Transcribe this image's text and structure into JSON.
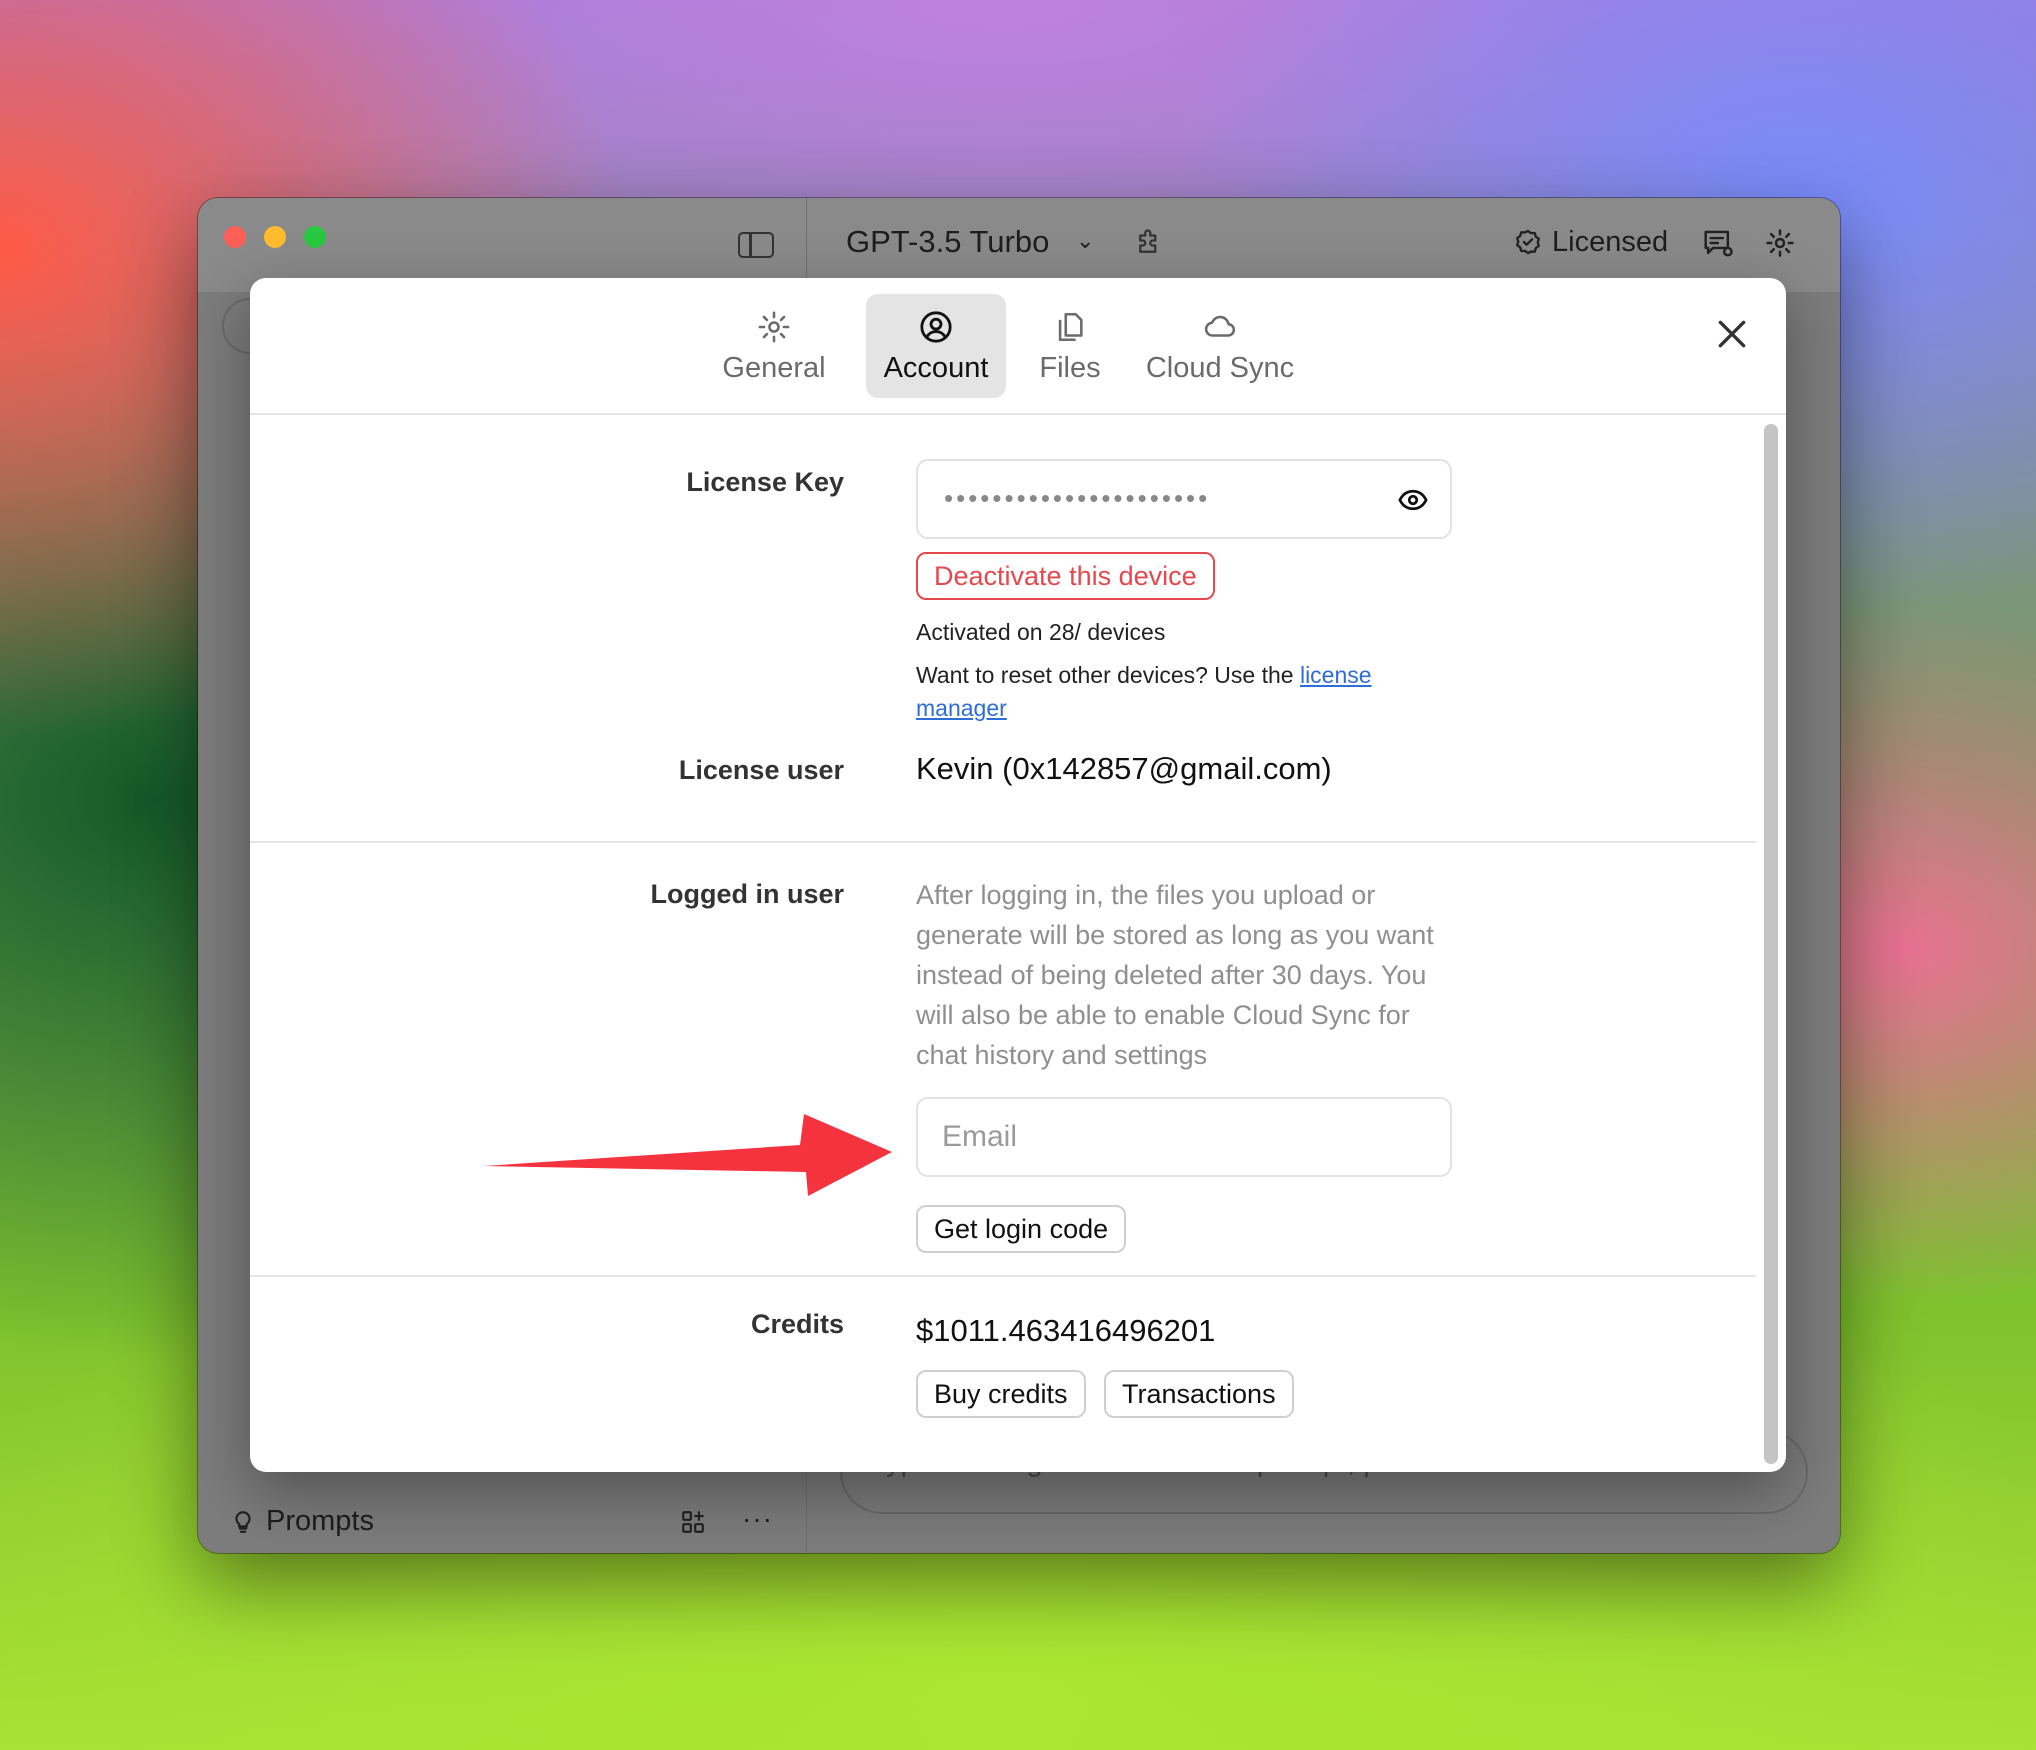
{
  "window": {
    "model_title": "GPT-3.5 Turbo",
    "licensed_label": "Licensed",
    "prompts_label": "Prompts",
    "message_placeholder": "Type message or / to select a prompt, press ↵ to send"
  },
  "settings": {
    "tabs": [
      {
        "label": "General",
        "icon": "gear-icon",
        "active": false
      },
      {
        "label": "Account",
        "icon": "user-circle-icon",
        "active": true
      },
      {
        "label": "Files",
        "icon": "files-icon",
        "active": false
      },
      {
        "label": "Cloud Sync",
        "icon": "cloud-icon",
        "active": false
      }
    ],
    "license": {
      "label": "License Key",
      "masked_value": "••••••••••••••••••••••",
      "deactivate_label": "Deactivate this device",
      "activated_text": "Activated on 28/ devices",
      "reset_text_prefix": "Want to reset other devices? Use the ",
      "reset_link": "license manager"
    },
    "license_user": {
      "label": "License user",
      "value": "Kevin (0x142857@gmail.com)"
    },
    "logged_in_user": {
      "label": "Logged in user",
      "description": "After logging in, the files you upload or generate will be stored as long as you want instead of being deleted after 30 days. You will also be able to enable Cloud Sync for chat history and settings",
      "email_placeholder": "Email",
      "get_code_label": "Get login code"
    },
    "credits": {
      "label": "Credits",
      "value": "$1011.463416496201",
      "buy_label": "Buy credits",
      "transactions_label": "Transactions"
    }
  },
  "colors": {
    "danger": "#e5484d",
    "link": "#2e6cd6",
    "annotation_arrow": "#f5333f"
  }
}
